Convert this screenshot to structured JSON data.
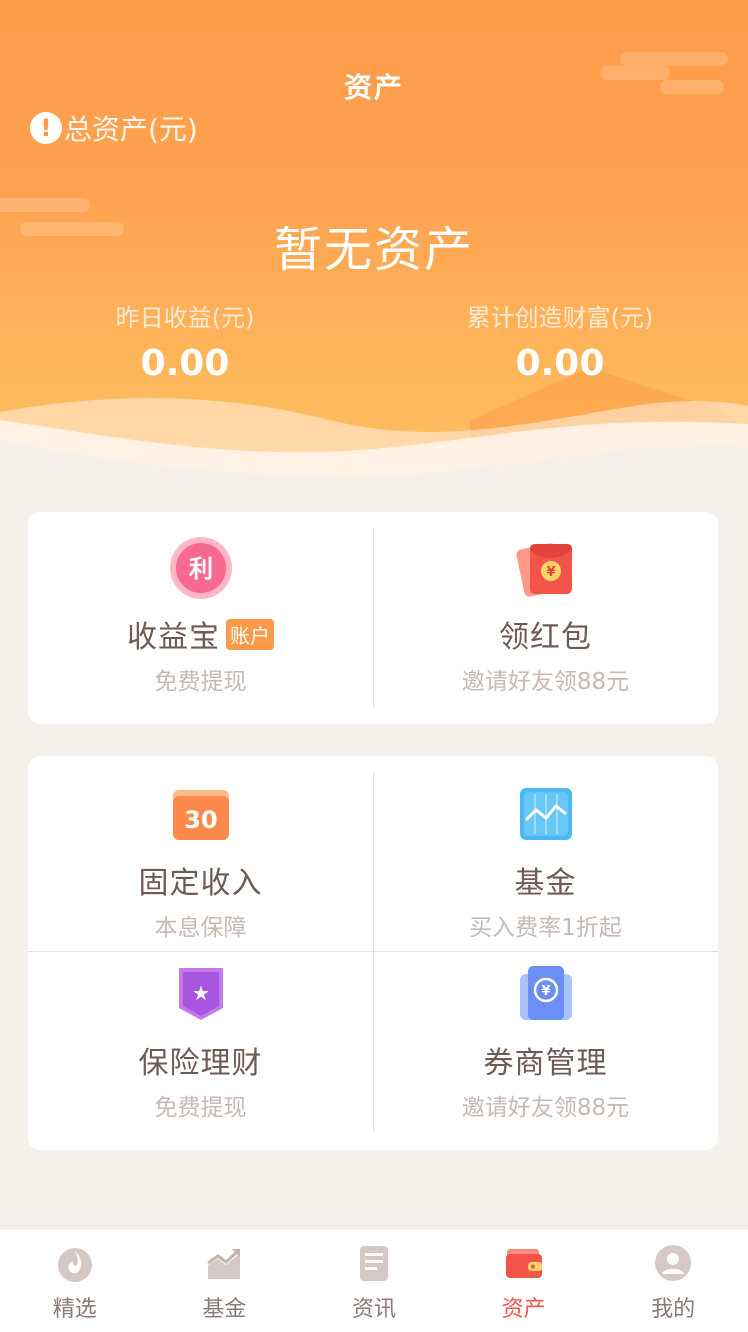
{
  "header": {
    "title": "资产",
    "total_label": "总资产(元)",
    "info_icon_glyph": "!",
    "status": "暂无资产",
    "yesterday_label": "昨日收益(元)",
    "yesterday_value": "0.00",
    "cumulative_label": "累计创造财富(元)",
    "cumulative_value": "0.00"
  },
  "card1": {
    "left": {
      "icon": "li-coin-icon",
      "icon_glyph": "利",
      "title": "收益宝",
      "tag": "账户",
      "subtitle": "免费提现"
    },
    "right": {
      "icon": "red-envelope-icon",
      "icon_glyph": "¥",
      "title": "领红包",
      "subtitle": "邀请好友领88元"
    }
  },
  "card2": {
    "items": [
      {
        "icon": "calendar-30-icon",
        "icon_glyph": "30",
        "title": "固定收入",
        "subtitle": "本息保障"
      },
      {
        "icon": "fund-chart-icon",
        "title": "基金",
        "subtitle": "买入费率1折起"
      },
      {
        "icon": "insurance-shield-icon",
        "icon_glyph": "★",
        "title": "保险理财",
        "subtitle": "免费提现"
      },
      {
        "icon": "securities-ticket-icon",
        "icon_glyph": "¥",
        "title": "券商管理",
        "subtitle": "邀请好友领88元"
      }
    ]
  },
  "tabbar": {
    "active_color": "#f2544a",
    "items": [
      {
        "label": "精选",
        "icon": "flame-icon"
      },
      {
        "label": "基金",
        "icon": "trend-chart-icon"
      },
      {
        "label": "资讯",
        "icon": "news-icon"
      },
      {
        "label": "资产",
        "icon": "wallet-icon",
        "active": true
      },
      {
        "label": "我的",
        "icon": "profile-icon"
      }
    ]
  },
  "colors": {
    "hero_top": "#fd9a48",
    "hero_bottom": "#ffbe62",
    "background": "#f5f0ea",
    "accent": "#fd9a48"
  }
}
